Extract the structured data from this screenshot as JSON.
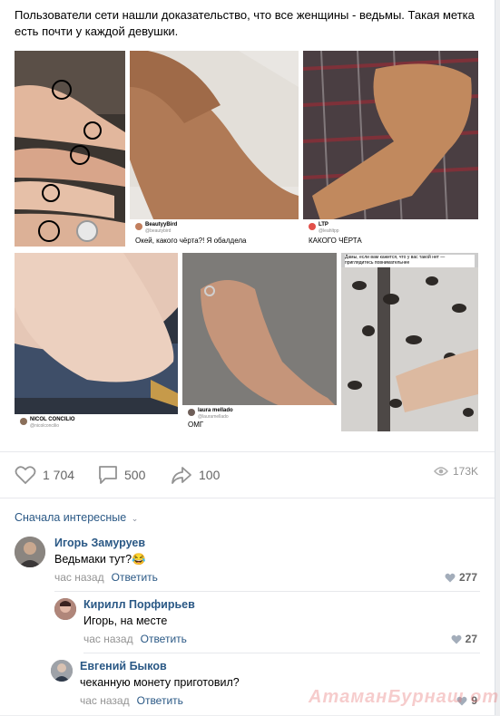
{
  "post": {
    "text": "Пользователи сети нашли доказательство, что все женщины - ведьмы. Такая метка есть почти у каждой девушки."
  },
  "photos": [
    {
      "caption_name": "",
      "caption_text": ""
    },
    {
      "caption_name": "BeautyyBird",
      "caption_handle": "@beautybird",
      "caption_text": "Окей, какого чёрта?! Я обалдела"
    },
    {
      "caption_name": "LTP",
      "caption_handle": "@leahltpp",
      "caption_text": "КАКОГО ЧЁРТА"
    },
    {
      "caption_name": "NICOL CONCILIO",
      "caption_handle": "@nicolconcilio",
      "caption_text": ""
    },
    {
      "caption_name": "laura mellado",
      "caption_handle": "@lauramellado",
      "caption_text": "ОМГ"
    },
    {
      "caption_name": "",
      "caption_text": "",
      "header_text": "Дамы, если вам кажется, что у вас такой нет — приглядитесь повнимательнее"
    }
  ],
  "actions": {
    "likes": "1 704",
    "comments": "500",
    "shares": "100",
    "views": "173K"
  },
  "comments_sort": "Сначала интересные",
  "comments": [
    {
      "author": "Игорь Замуруев",
      "text": "Ведьмаки тут?",
      "emoji": "😂",
      "time": "час назад",
      "reply": "Ответить",
      "likes": "277"
    },
    {
      "author": "Кирилл Порфирьев",
      "text": "Игорь, на месте",
      "time": "час назад",
      "reply": "Ответить",
      "likes": "27"
    },
    {
      "author": "Евгений Быков",
      "text": "чеканную монету приготовил?",
      "time": "час назад",
      "reply": "Ответить",
      "likes": "9"
    }
  ],
  "watermark": "АтаманБурнаш от ЯП"
}
